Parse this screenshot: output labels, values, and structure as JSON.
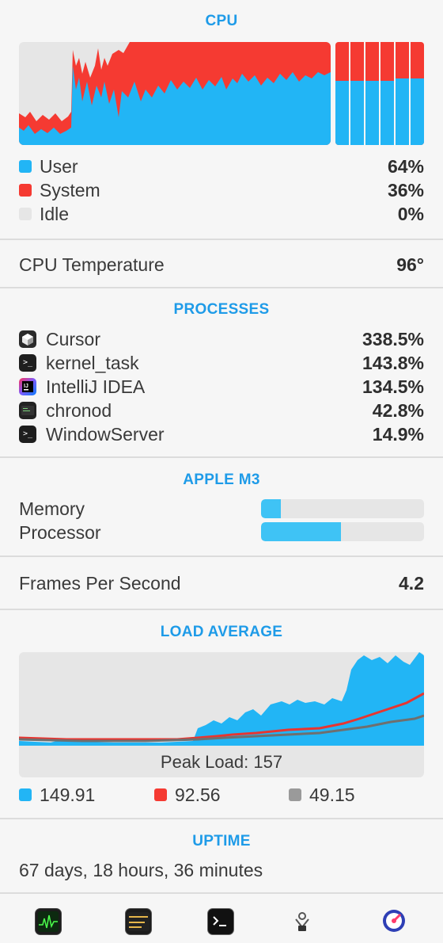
{
  "cpu": {
    "title": "CPU",
    "legend": [
      {
        "label": "User",
        "value": "64%",
        "color": "#22b5f5"
      },
      {
        "label": "System",
        "value": "36%",
        "color": "#f53a32"
      },
      {
        "label": "Idle",
        "value": "0%",
        "color": "#e6e6e6"
      }
    ],
    "core_user_fraction": [
      0.62,
      0.62,
      0.62,
      0.62,
      0.65,
      0.65
    ]
  },
  "temperature": {
    "label": "CPU Temperature",
    "value": "96°"
  },
  "processes": {
    "title": "PROCESSES",
    "items": [
      {
        "name": "Cursor",
        "value": "338.5%",
        "icon": "cursor-app-icon"
      },
      {
        "name": "kernel_task",
        "value": "143.8%",
        "icon": "terminal-icon"
      },
      {
        "name": "IntelliJ IDEA",
        "value": "134.5%",
        "icon": "intellij-icon"
      },
      {
        "name": "chronod",
        "value": "42.8%",
        "icon": "console-icon"
      },
      {
        "name": "WindowServer",
        "value": "14.9%",
        "icon": "terminal-icon"
      }
    ]
  },
  "gpu": {
    "title": "APPLE M3",
    "rows": [
      {
        "label": "Memory",
        "fraction": 0.12
      },
      {
        "label": "Processor",
        "fraction": 0.49
      }
    ]
  },
  "fps": {
    "label": "Frames Per Second",
    "value": "4.2"
  },
  "load": {
    "title": "LOAD AVERAGE",
    "peak_label": "Peak Load: 157",
    "legend": [
      {
        "value": "149.91",
        "color": "#22b5f5"
      },
      {
        "value": "92.56",
        "color": "#f53a32"
      },
      {
        "value": "49.15",
        "color": "#9a9a9a"
      }
    ]
  },
  "uptime": {
    "title": "UPTIME",
    "value": "67 days, 18 hours, 36 minutes"
  },
  "dock": [
    "activity-monitor-icon",
    "console-icon",
    "terminal-icon",
    "system-information-icon",
    "istat-icon"
  ]
}
